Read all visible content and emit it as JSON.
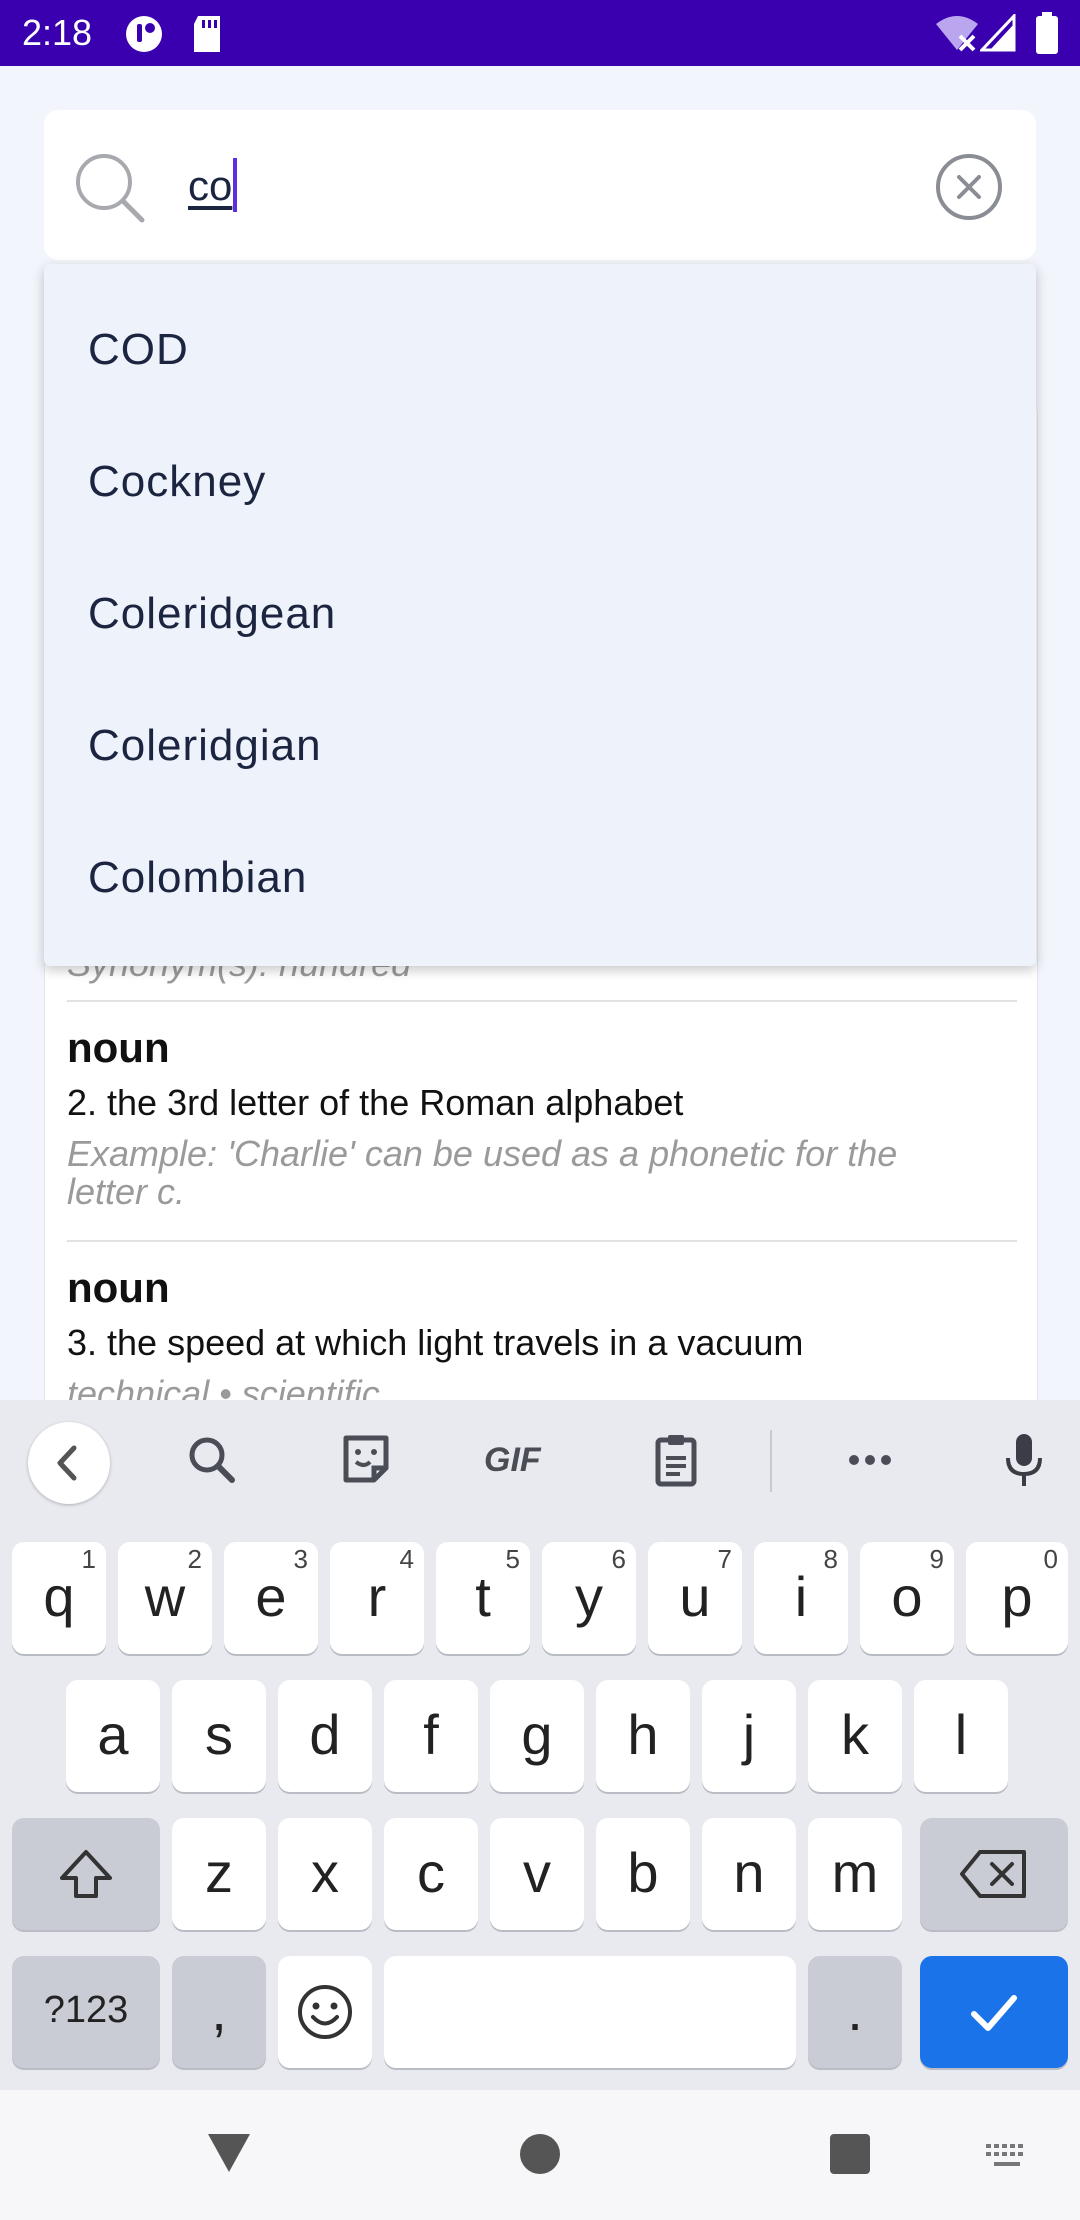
{
  "status_bar": {
    "time": "2:18",
    "icons": [
      "app-notification-icon",
      "sd-card-icon",
      "wifi-off-icon",
      "signal-icon",
      "battery-icon"
    ]
  },
  "search": {
    "query": "co",
    "search_icon": "search-icon",
    "clear_icon": "clear-circle-icon"
  },
  "suggestions": [
    "COD",
    "Cockney",
    "Coleridgean",
    "Coleridgian",
    "Colombian"
  ],
  "definitions": {
    "partial_synonyms": "Synonym(s): hundred",
    "items": [
      {
        "pos": "noun",
        "text": "2. the 3rd letter of the Roman alphabet",
        "example_line1": "Example: 'Charlie' can be used as a phonetic for the",
        "example_line2": "letter c."
      },
      {
        "pos": "noun",
        "text": "3. the speed at which light travels in a vacuum",
        "tags": "technical • scientific"
      }
    ]
  },
  "keyboard": {
    "toolbar": [
      "back-chevron-icon",
      "search-icon",
      "sticker-icon",
      "GIF",
      "clipboard-icon",
      "more-icon",
      "microphone-icon"
    ],
    "row1": [
      {
        "k": "q",
        "h": "1"
      },
      {
        "k": "w",
        "h": "2"
      },
      {
        "k": "e",
        "h": "3"
      },
      {
        "k": "r",
        "h": "4"
      },
      {
        "k": "t",
        "h": "5"
      },
      {
        "k": "y",
        "h": "6"
      },
      {
        "k": "u",
        "h": "7"
      },
      {
        "k": "i",
        "h": "8"
      },
      {
        "k": "o",
        "h": "9"
      },
      {
        "k": "p",
        "h": "0"
      }
    ],
    "row2": [
      "a",
      "s",
      "d",
      "f",
      "g",
      "h",
      "j",
      "k",
      "l"
    ],
    "row3": [
      "z",
      "x",
      "c",
      "v",
      "b",
      "n",
      "m"
    ],
    "symbols_label": "?123",
    "comma": ",",
    "period": ".",
    "accent_color": "#1a73e8"
  },
  "nav_bar": {
    "buttons": [
      "back-triangle-icon",
      "home-circle-icon",
      "recents-square-icon",
      "keyboard-switch-icon"
    ]
  }
}
